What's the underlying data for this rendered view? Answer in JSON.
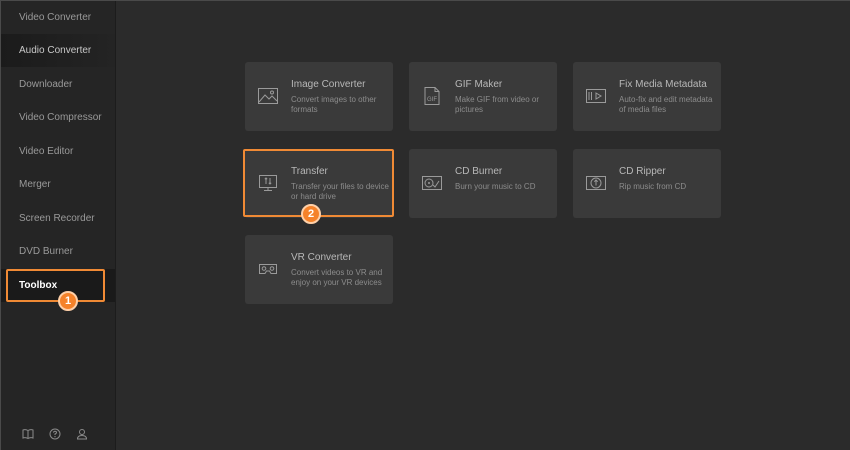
{
  "sidebar": {
    "items": [
      {
        "label": "Video Converter"
      },
      {
        "label": "Audio Converter"
      },
      {
        "label": "Downloader"
      },
      {
        "label": "Video Compressor"
      },
      {
        "label": "Video Editor"
      },
      {
        "label": "Merger"
      },
      {
        "label": "Screen Recorder"
      },
      {
        "label": "DVD Burner"
      },
      {
        "label": "Toolbox"
      }
    ],
    "footer_icons": [
      "book-icon",
      "help-icon",
      "account-icon"
    ]
  },
  "toolbox": {
    "cards": [
      {
        "title": "Image Converter",
        "desc": "Convert images to other formats",
        "icon": "image-icon"
      },
      {
        "title": "GIF Maker",
        "desc": "Make GIF from video or pictures",
        "icon": "gif-icon"
      },
      {
        "title": "Fix Media Metadata",
        "desc": "Auto-fix and edit metadata of media files",
        "icon": "metadata-icon"
      },
      {
        "title": "Transfer",
        "desc": "Transfer your files to device or hard drive",
        "icon": "transfer-icon"
      },
      {
        "title": "CD Burner",
        "desc": "Burn your music to CD",
        "icon": "cd-burner-icon"
      },
      {
        "title": "CD Ripper",
        "desc": "Rip music from CD",
        "icon": "cd-ripper-icon"
      },
      {
        "title": "VR Converter",
        "desc": "Convert videos to VR and enjoy on your VR devices",
        "icon": "vr-icon"
      }
    ]
  },
  "annotations": {
    "step1": "1",
    "step2": "2",
    "highlight_color": "#f08a35"
  }
}
